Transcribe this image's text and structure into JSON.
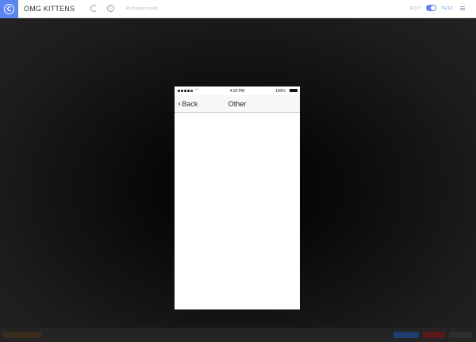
{
  "app": {
    "title": "OMG KITTENS",
    "logo_icon": "circular-c-logo-icon",
    "logo_glyph": "C"
  },
  "toolbar": {
    "save_status": "All changes saved",
    "refresh_icon": "refresh-icon",
    "info_icon": "info-icon",
    "info_glyph": "i",
    "edit_label": "EDIT",
    "test_label": "TEST",
    "mode_toggle_on": true,
    "menu_icon": "hamburger-menu-icon"
  },
  "device": {
    "status_bar": {
      "time": "4:20 PM",
      "battery": "100%"
    },
    "nav_bar": {
      "back_label": "Back",
      "title": "Other"
    }
  },
  "colors": {
    "accent": "#5b86f2",
    "stage_bg": "#1a1a1a",
    "bottom_bar_items": [
      "#3a2c1c",
      "#1f3d6e",
      "#5a1a1a",
      "#2e2e2e"
    ]
  }
}
